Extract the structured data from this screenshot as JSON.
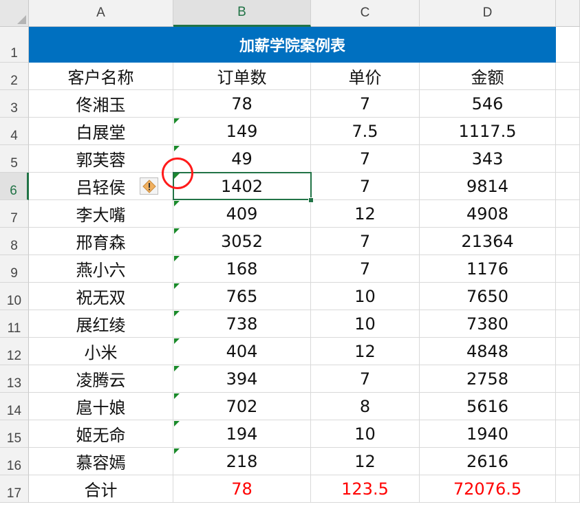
{
  "columns": [
    {
      "label": "A"
    },
    {
      "label": "B"
    },
    {
      "label": "C"
    },
    {
      "label": "D"
    }
  ],
  "rows": [
    "1",
    "2",
    "3",
    "4",
    "5",
    "6",
    "7",
    "8",
    "9",
    "10",
    "11",
    "12",
    "13",
    "14",
    "15",
    "16",
    "17"
  ],
  "sheet": {
    "title": "加薪学院案例表",
    "headers": [
      "客户名称",
      "订单数",
      "单价",
      "金额"
    ],
    "records": [
      [
        "佟湘玉",
        "78",
        "7",
        "546"
      ],
      [
        "白展堂",
        "149",
        "7.5",
        "1117.5"
      ],
      [
        "郭芙蓉",
        "49",
        "7",
        "343"
      ],
      [
        "吕轻侯",
        "1402",
        "7",
        "9814"
      ],
      [
        "李大嘴",
        "409",
        "12",
        "4908"
      ],
      [
        "邢育森",
        "3052",
        "7",
        "21364"
      ],
      [
        "燕小六",
        "168",
        "7",
        "1176"
      ],
      [
        "祝无双",
        "765",
        "10",
        "7650"
      ],
      [
        "展红绫",
        "738",
        "10",
        "7380"
      ],
      [
        "小米",
        "404",
        "12",
        "4848"
      ],
      [
        "凌腾云",
        "394",
        "7",
        "2758"
      ],
      [
        "扈十娘",
        "702",
        "8",
        "5616"
      ],
      [
        "姬无命",
        "194",
        "10",
        "1940"
      ],
      [
        "慕容嫣",
        "218",
        "12",
        "2616"
      ]
    ],
    "total": [
      "合计",
      "78",
      "123.5",
      "72076.5"
    ]
  },
  "selection": {
    "cell": "B6",
    "row": "6",
    "column": "B"
  },
  "colors": {
    "title_bg": "#0070c0",
    "total_text": "#ff0000",
    "accent": "#217346",
    "error_indicator": "#1a8a2a"
  },
  "icons": {
    "error_check": "warning-diamond-icon",
    "annotation": "red-circle-annotation"
  }
}
